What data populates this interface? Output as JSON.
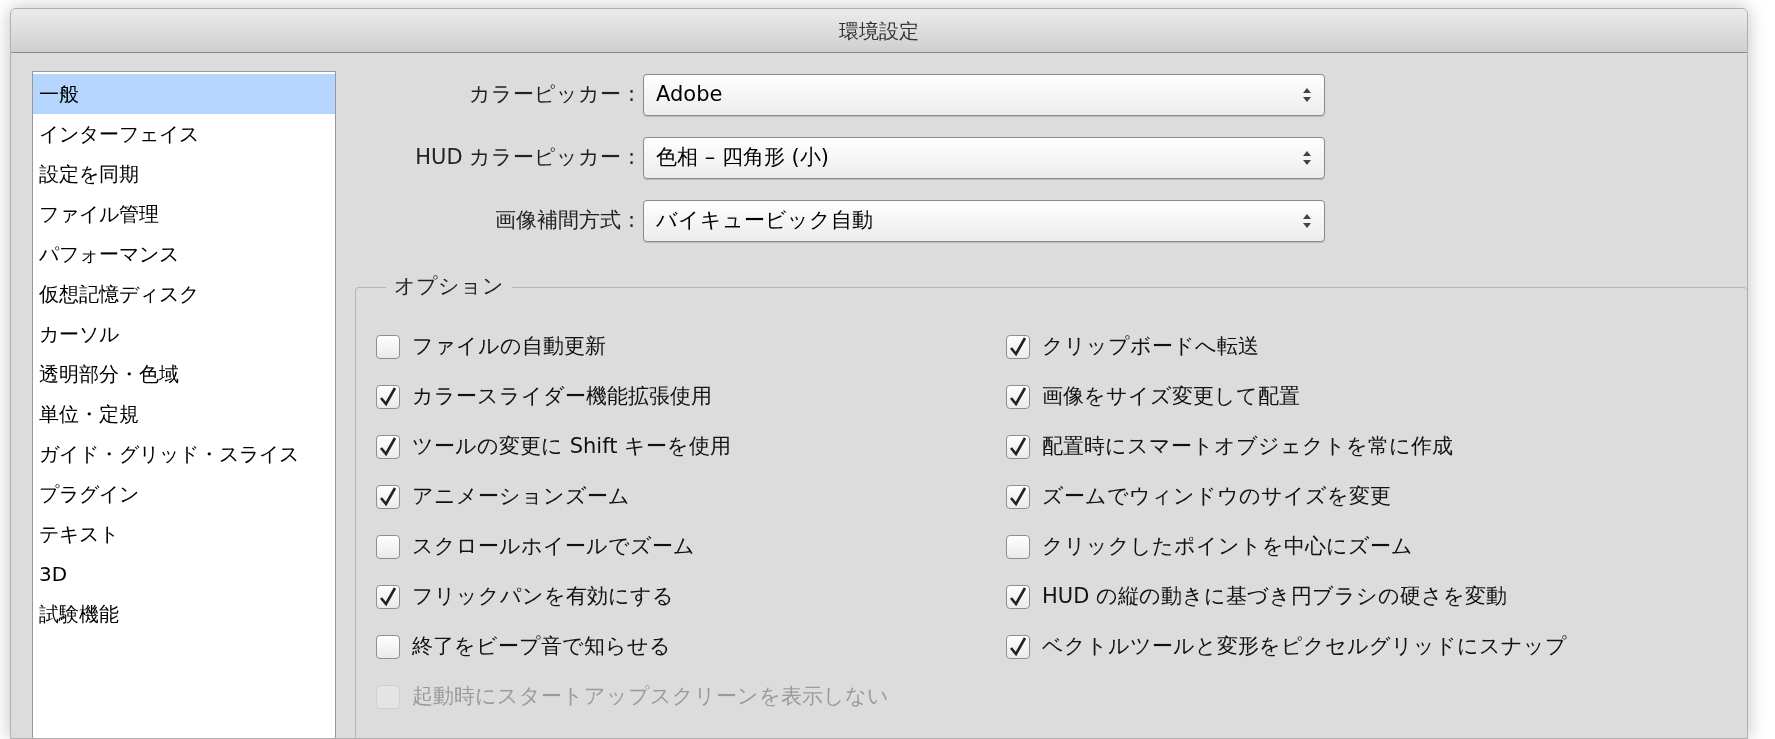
{
  "window": {
    "title": "環境設定"
  },
  "sidebar": {
    "items": [
      {
        "label": "一般",
        "selected": true
      },
      {
        "label": "インターフェイス",
        "selected": false
      },
      {
        "label": "設定を同期",
        "selected": false
      },
      {
        "label": "ファイル管理",
        "selected": false
      },
      {
        "label": "パフォーマンス",
        "selected": false
      },
      {
        "label": "仮想記憶ディスク",
        "selected": false
      },
      {
        "label": "カーソル",
        "selected": false
      },
      {
        "label": "透明部分・色域",
        "selected": false
      },
      {
        "label": "単位・定規",
        "selected": false
      },
      {
        "label": "ガイド・グリッド・スライス",
        "selected": false
      },
      {
        "label": "プラグイン",
        "selected": false
      },
      {
        "label": "テキスト",
        "selected": false
      },
      {
        "label": "3D",
        "selected": false
      },
      {
        "label": "試験機能",
        "selected": false
      }
    ]
  },
  "settings": [
    {
      "label": "カラーピッカー :",
      "value": "Adobe"
    },
    {
      "label": "HUD カラーピッカー :",
      "value": "色相 – 四角形 (小)"
    },
    {
      "label": "画像補間方式 :",
      "value": "バイキュービック自動"
    }
  ],
  "options": {
    "title": "オプション",
    "left_column": [
      {
        "label": "ファイルの自動更新",
        "checked": false,
        "disabled": false
      },
      {
        "label": "カラースライダー機能拡張使用",
        "checked": true,
        "disabled": false
      },
      {
        "label": "ツールの変更に Shift キーを使用",
        "checked": true,
        "disabled": false
      },
      {
        "label": "アニメーションズーム",
        "checked": true,
        "disabled": false
      },
      {
        "label": "スクロールホイールでズーム",
        "checked": false,
        "disabled": false
      },
      {
        "label": "フリックパンを有効にする",
        "checked": true,
        "disabled": false
      },
      {
        "label": "終了をビープ音で知らせる",
        "checked": false,
        "disabled": false
      },
      {
        "label": "起動時にスタートアップスクリーンを表示しない",
        "checked": false,
        "disabled": true
      }
    ],
    "right_column": [
      {
        "label": "クリップボードへ転送",
        "checked": true,
        "disabled": false
      },
      {
        "label": "画像をサイズ変更して配置",
        "checked": true,
        "disabled": false
      },
      {
        "label": "配置時にスマートオブジェクトを常に作成",
        "checked": true,
        "disabled": false
      },
      {
        "label": "ズームでウィンドウのサイズを変更",
        "checked": true,
        "disabled": false
      },
      {
        "label": "クリックしたポイントを中心にズーム",
        "checked": false,
        "disabled": false
      },
      {
        "label": "HUD の縦の動きに基づき円ブラシの硬さを変動",
        "checked": true,
        "disabled": false
      },
      {
        "label": "ベクトルツールと変形をピクセルグリッドにスナップ",
        "checked": true,
        "disabled": false
      }
    ]
  }
}
